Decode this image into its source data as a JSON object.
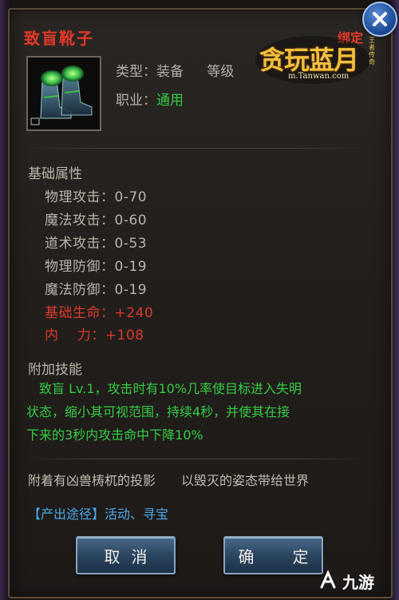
{
  "item": {
    "name": "致盲靴子",
    "binding": "绑定",
    "type_line": "类型：装备",
    "level_fragment": "等级",
    "job_label": "职业：",
    "job_value": "通用"
  },
  "logo": {
    "title": "贪玩蓝月",
    "side": "王者传奇",
    "url": "m.Tanwan.com"
  },
  "base_attributes": {
    "label": "基础属性",
    "stats": [
      {
        "text": "物理攻击：0-70",
        "color": "normal"
      },
      {
        "text": "魔法攻击：0-60",
        "color": "normal"
      },
      {
        "text": "道术攻击：0-53",
        "color": "normal"
      },
      {
        "text": "物理防御：0-19",
        "color": "normal"
      },
      {
        "text": "魔法防御：0-19",
        "color": "normal"
      },
      {
        "text": "基础生命：+240",
        "color": "red"
      },
      {
        "text": "内　 力：+108",
        "color": "red"
      }
    ]
  },
  "skill": {
    "label": "附加技能",
    "lines": [
      "　致盲 Lv.1，攻击时有10%几率使目标进入失明",
      "状态，缩小其可视范围，持续4秒，并使其在接",
      "下来的3秒内攻击命中下降10%"
    ]
  },
  "flavor_text": "附着有凶兽梼杌的投影　　以毁灭的姿态带给世界",
  "source": "【产出途径】活动、寻宝",
  "buttons": {
    "cancel": "取消",
    "confirm": "确　定"
  },
  "watermark": {
    "text": "九游"
  },
  "colors": {
    "title_red": "#e23a2a",
    "green": "#33cc44",
    "blue": "#4aa8e8",
    "stat_red": "#d8392c"
  }
}
